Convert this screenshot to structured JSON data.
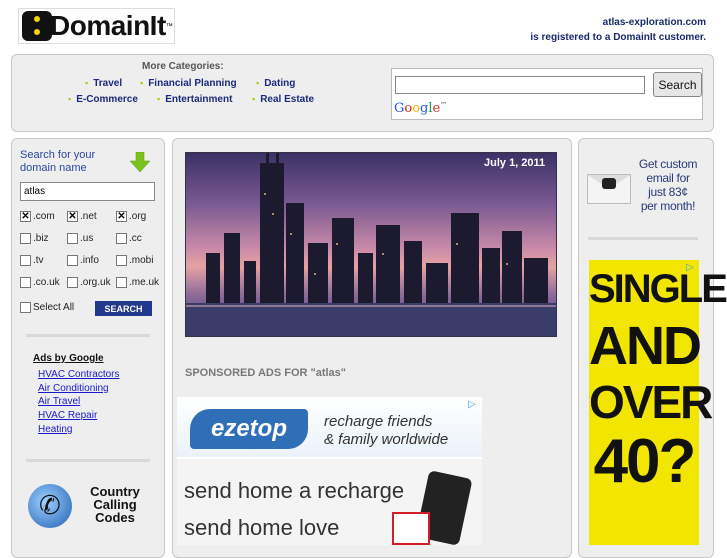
{
  "header": {
    "logo_text": "DomainIt",
    "logo_tm": "™",
    "registered_line1": "atlas-exploration.com",
    "registered_line2": "is registered to a DomainIt customer."
  },
  "categories": {
    "title": "More Categories:",
    "row1": [
      "Travel",
      "Financial Planning",
      "Dating"
    ],
    "row2": [
      "E-Commerce",
      "Entertainment",
      "Real Estate"
    ]
  },
  "google_search": {
    "button_label": "Search",
    "input_value": "",
    "logo_text": "Google",
    "logo_tm": "™"
  },
  "domain_search": {
    "title_line1": "Search for your",
    "title_line2": "domain name",
    "input_value": "atlas",
    "tlds": [
      {
        "label": ".com",
        "checked": true
      },
      {
        "label": ".net",
        "checked": true
      },
      {
        "label": ".org",
        "checked": true
      },
      {
        "label": ".biz",
        "checked": false
      },
      {
        "label": ".us",
        "checked": false
      },
      {
        "label": ".cc",
        "checked": false
      },
      {
        "label": ".tv",
        "checked": false
      },
      {
        "label": ".info",
        "checked": false
      },
      {
        "label": ".mobi",
        "checked": false
      },
      {
        "label": ".co.uk",
        "checked": false
      },
      {
        "label": ".org.uk",
        "checked": false
      },
      {
        "label": ".me.uk",
        "checked": false
      }
    ],
    "select_all_label": "Select All",
    "search_button_label": "SEARCH"
  },
  "ads_by_google": {
    "title": "Ads by Google",
    "links": [
      "HVAC Contractors",
      "Air Conditioning",
      "Air Travel",
      "HVAC Repair",
      "Heating"
    ]
  },
  "country_calling": {
    "line1": "Country",
    "line2": "Calling",
    "line3": "Codes"
  },
  "main": {
    "photo_date": "July 1, 2011",
    "sponsored_title": "SPONSORED ADS FOR \"atlas\""
  },
  "ezetop_ad": {
    "logo": "ezetop",
    "tag_line1": "recharge friends",
    "tag_line2": "& family worldwide",
    "line1": "send home a recharge",
    "line2": "send home love"
  },
  "email_promo": {
    "line1": "Get custom",
    "line2": "email for",
    "line3": "just 83¢",
    "line4": "per month!"
  },
  "single_ad": {
    "line1": "SINGLE",
    "line2": "AND",
    "line3": "OVER",
    "line4": "40?"
  },
  "colors": {
    "brand_blue": "#22388a",
    "link_blue": "#1a1acc",
    "accent_green": "#b4c21a",
    "ad_yellow": "#f2e600"
  }
}
